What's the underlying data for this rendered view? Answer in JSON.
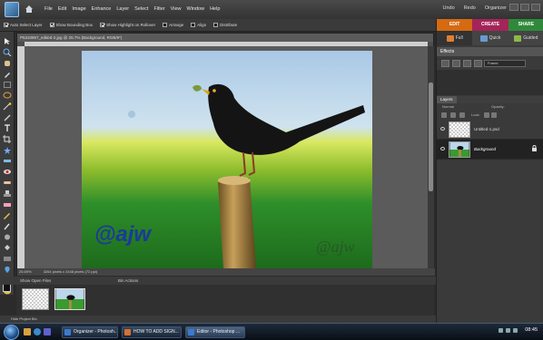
{
  "menubar": {
    "menus": [
      "File",
      "Edit",
      "Image",
      "Enhance",
      "Layer",
      "Select",
      "Filter",
      "View",
      "Window",
      "Help"
    ],
    "undo": "Undo",
    "redo": "Redo",
    "organizer": "Organizer"
  },
  "options": {
    "auto_select": "Auto Select Layer",
    "bounding_box": "Show Bounding Box",
    "highlight": "Show Highlight on Rollover",
    "arrange": "Arrange",
    "align": "Align",
    "distribute": "Distribute"
  },
  "document": {
    "title": "P5310857_edited-2.jpg @ 25.7% (Background, RGB/8*)",
    "zoom": "25.69%",
    "size": "3264 pixels x 2448 pixels (72 ppi)",
    "watermark": "@ajw"
  },
  "bin": {
    "show_open_files": "Show Open Files",
    "bin_actions": "Bin Actions",
    "hide": "Hide Project Bin"
  },
  "panel": {
    "modes": [
      "EDIT",
      "CREATE",
      "SHARE"
    ],
    "subtabs": [
      "Full",
      "Quick",
      "Guided"
    ],
    "effects_title": "Effects",
    "frame_select": "Frame",
    "layers_tab": "Layers",
    "blend": "Normal",
    "opacity": "Opacity:",
    "lock": "Lock:",
    "layers": [
      "Untitled-1.psd",
      "Background"
    ]
  },
  "taskbar": {
    "items": [
      "Organizer - Photosh...",
      "HOW TO ADD SIGN...",
      "Editor - Photoshop ..."
    ],
    "clock": "08:45"
  },
  "colors": {
    "edit": "#d56a12",
    "create": "#a5245a",
    "share": "#2e8a3a"
  }
}
